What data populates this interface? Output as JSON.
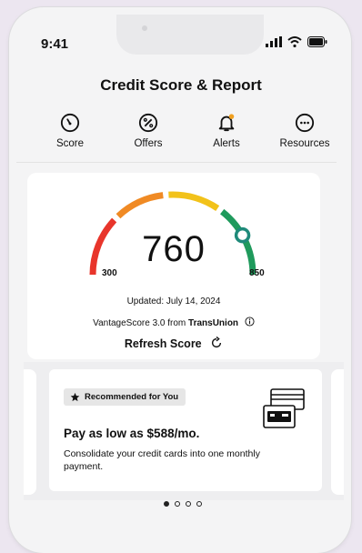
{
  "status_bar": {
    "time": "9:41"
  },
  "header": {
    "title": "Credit Score & Report"
  },
  "tabs": [
    {
      "label": "Score",
      "icon": "speedometer-icon"
    },
    {
      "label": "Offers",
      "icon": "percent-icon"
    },
    {
      "label": "Alerts",
      "icon": "bell-icon"
    },
    {
      "label": "Resources",
      "icon": "more-icon"
    }
  ],
  "score": {
    "value": "760",
    "min_label": "300",
    "max_label": "850",
    "updated": "Updated: July 14, 2024",
    "model_prefix": "VantageScore 3.0 from ",
    "model_bureau": "TransUnion",
    "refresh_label": "Refresh Score",
    "score_fraction": 0.836,
    "colors": {
      "red": "#e8352b",
      "orange": "#f08a24",
      "yellow": "#f2c21a",
      "green": "#1f9a5c"
    }
  },
  "promo": {
    "badge": "Recommended for You",
    "title": "Pay as low as $588/mo.",
    "description": "Consolidate your credit cards into one monthly payment."
  },
  "carousel": {
    "pages": 4,
    "active": 0
  }
}
